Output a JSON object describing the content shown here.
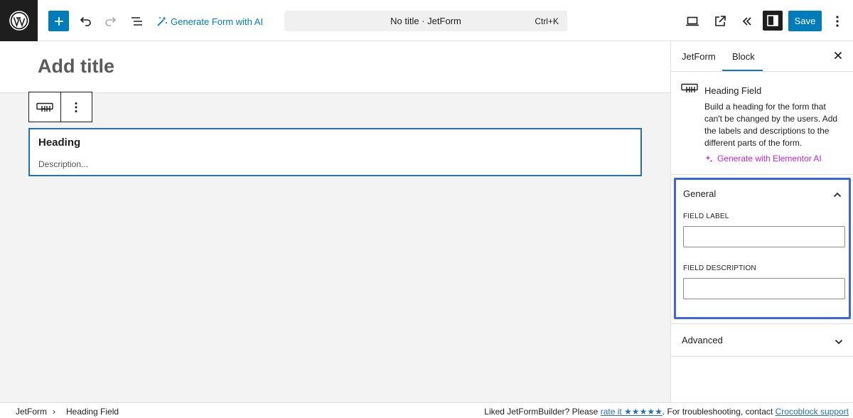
{
  "topbar": {
    "generate_ai_label": "Generate Form with AI",
    "command_title": "No title · JetForm",
    "command_shortcut": "Ctrl+K",
    "save_label": "Save"
  },
  "editor": {
    "title_placeholder": "Add title",
    "heading_block": {
      "heading": "Heading",
      "description": "Description..."
    }
  },
  "sidebar": {
    "tabs": [
      {
        "label": "JetForm",
        "active": false
      },
      {
        "label": "Block",
        "active": true
      }
    ],
    "block_card": {
      "name": "Heading Field",
      "description": "Build a heading for the form that can't be changed by the users. Add the labels and descriptions to the different parts of the form.",
      "generate_link": "Generate with Elementor AI"
    },
    "general_panel": {
      "title": "General",
      "field_label_caption": "FIELD LABEL",
      "field_label_value": "",
      "field_description_caption": "FIELD DESCRIPTION",
      "field_description_value": ""
    },
    "advanced_panel": {
      "title": "Advanced"
    }
  },
  "footer": {
    "breadcrumb": [
      "JetForm",
      "Heading Field"
    ],
    "liked_text": "Liked JetFormBuilder? Please ",
    "rate_link": "rate it ★★★★★",
    "trouble_text": ". For troubleshooting, contact ",
    "support_link": "Crocoblock support"
  },
  "colors": {
    "accent": "#007cba",
    "highlight_box": "#3c64e6",
    "ai_link": "#c026d3"
  }
}
